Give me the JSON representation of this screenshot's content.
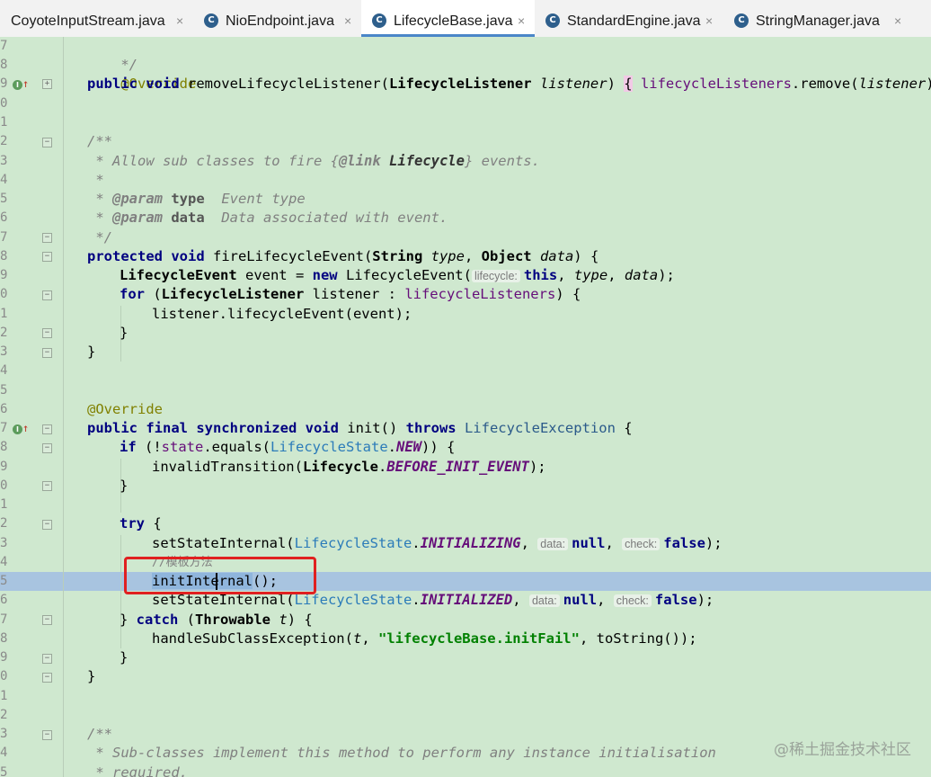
{
  "tabs": [
    {
      "label": "CoyoteInputStream.java",
      "active": false
    },
    {
      "label": "NioEndpoint.java",
      "active": false
    },
    {
      "label": "LifecycleBase.java",
      "active": true
    },
    {
      "label": "StandardEngine.java",
      "active": false
    },
    {
      "label": "StringManager.java",
      "active": false
    }
  ],
  "tab_close_glyph": "×",
  "tab_icon_letter": "C",
  "line_numbers": [
    "7",
    "8",
    "9",
    "0",
    "1",
    "2",
    "3",
    "4",
    "5",
    "6",
    "7",
    "8",
    "9",
    "0",
    "1",
    "2",
    "3",
    "4",
    "5",
    "6",
    "7",
    "8",
    "9",
    "0",
    "1",
    "2",
    "3",
    "4",
    "5",
    "6",
    "7",
    "8",
    "9",
    "0",
    "1",
    "2",
    "3",
    "4",
    "5",
    "6"
  ],
  "code": {
    "l0": "*/",
    "l1": "@Override",
    "l2": {
      "kw": "public void ",
      "name": "removeLifecycleListener(",
      "ptype": "LifecycleListener ",
      "pname": "listener",
      "close": ") ",
      "open": "{",
      "body_field": " lifecycleListeners",
      "body_rest": ".remove(",
      "arg": "listener",
      "end": "); ",
      "closebrace": "}"
    },
    "l5": "/**",
    "l6": {
      "a": " * Allow sub classes to fire {",
      "tag": "@link",
      "b": " ",
      "ref": "Lifecycle",
      "c": "} events."
    },
    "l7": " *",
    "l8": {
      "a": " * ",
      "tag": "@param",
      "b": " ",
      "name": "type",
      "c": "  Event type"
    },
    "l9": {
      "a": " * ",
      "tag": "@param",
      "b": " ",
      "name": "data",
      "c": "  Data associated with event."
    },
    "l10": " */",
    "l11": {
      "kw": "protected void ",
      "name": "fireLifecycleEvent(",
      "t1": "String ",
      "p1": "type",
      "sep": ", ",
      "t2": "Object ",
      "p2": "data",
      "end": ") {"
    },
    "l12": {
      "t": "LifecycleEvent ",
      "v": "event = ",
      "kw": "new ",
      "ctor": "LifecycleEvent(",
      "hint": "lifecycle:",
      "this": "this",
      "sep1": ", ",
      "p1": "type",
      "sep2": ", ",
      "p2": "data",
      "end": ");"
    },
    "l13": {
      "kw": "for ",
      "a": "(",
      "t": "LifecycleListener ",
      "v": "listener : ",
      "fld": "lifecycleListeners",
      "end": ") {"
    },
    "l14": "listener.lifecycleEvent(event);",
    "l15": "}",
    "l16": "}",
    "l19": "@Override",
    "l20": {
      "kw": "public final synchronized void ",
      "name": "init() ",
      "kw2": "throws ",
      "t": "LifecycleException",
      "end": " {"
    },
    "l21": {
      "kw": "if ",
      "a": "(!",
      "fld": "state",
      "b": ".equals(",
      "enum": "LifecycleState",
      "dot": ".",
      "const": "NEW",
      "end": ")) {"
    },
    "l22": {
      "a": "invalidTransition(",
      "t": "Lifecycle",
      "dot": ".",
      "const": "BEFORE_INIT_EVENT",
      "end": ");"
    },
    "l23": "}",
    "l25": {
      "kw": "try",
      "end": " {"
    },
    "l26": {
      "a": "setStateInternal(",
      "enum": "LifecycleState",
      "dot": ".",
      "const": "INITIALIZING",
      "sep": ", ",
      "h1": "data:",
      "n1": "null",
      "sep2": ", ",
      "h2": "check:",
      "n2": "false",
      "end": ");"
    },
    "l27": "//模板方法",
    "l28": {
      "sel": "initInternal",
      "end": "();"
    },
    "l29": {
      "a": "setStateInternal(",
      "enum": "LifecycleState",
      "dot": ".",
      "const": "INITIALIZED",
      "sep": ", ",
      "h1": "data:",
      "n1": "null",
      "sep2": ", ",
      "h2": "check:",
      "n2": "false",
      "end": ");"
    },
    "l30": {
      "a": "} ",
      "kw": "catch ",
      "b": "(",
      "t": "Throwable ",
      "p": "t",
      "end": ") {"
    },
    "l31": {
      "a": "handleSubClassException(",
      "p": "t",
      "sep": ", ",
      "str": "\"lifecycleBase.initFail\"",
      "sep2": ", ",
      "b": "toString());"
    },
    "l32": "}",
    "l33": "}",
    "l36": "/**",
    "l37": " * Sub-classes implement this method to perform any instance initialisation",
    "l38": " * required."
  },
  "watermark": "@稀土掘金技术社区"
}
